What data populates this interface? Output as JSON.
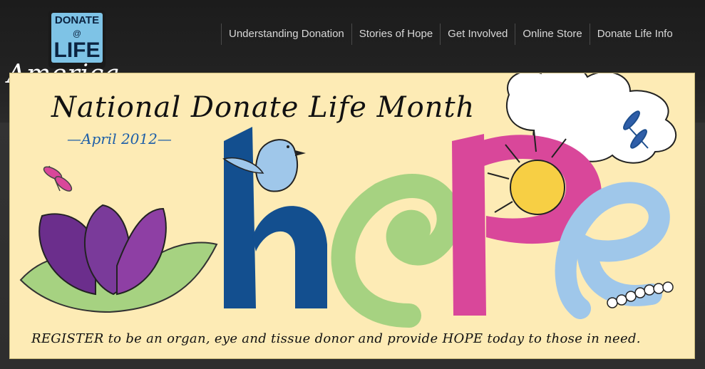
{
  "logo": {
    "line1": "DONATE",
    "line2": "ꩡ",
    "line3": "LIFE",
    "script": "America"
  },
  "nav": {
    "items": [
      {
        "label": "Understanding Donation"
      },
      {
        "label": "Stories of Hope"
      },
      {
        "label": "Get Involved"
      },
      {
        "label": "Online Store"
      },
      {
        "label": "Donate Life Info"
      }
    ]
  },
  "banner": {
    "title": "National Donate Life Month",
    "date": "—April 2012—",
    "word": "hope",
    "footer": "REGISTER to be an organ, eye and tissue donor and provide HOPE today to those in need.",
    "colors": {
      "background": "#fdebb5",
      "h": "#134f8f",
      "o": "#a6d281",
      "p": "#d9479a",
      "e": "#9fc7ea",
      "flower": "#6b2e8c",
      "leaf": "#a6d281",
      "sun": "#f7cf44"
    }
  }
}
